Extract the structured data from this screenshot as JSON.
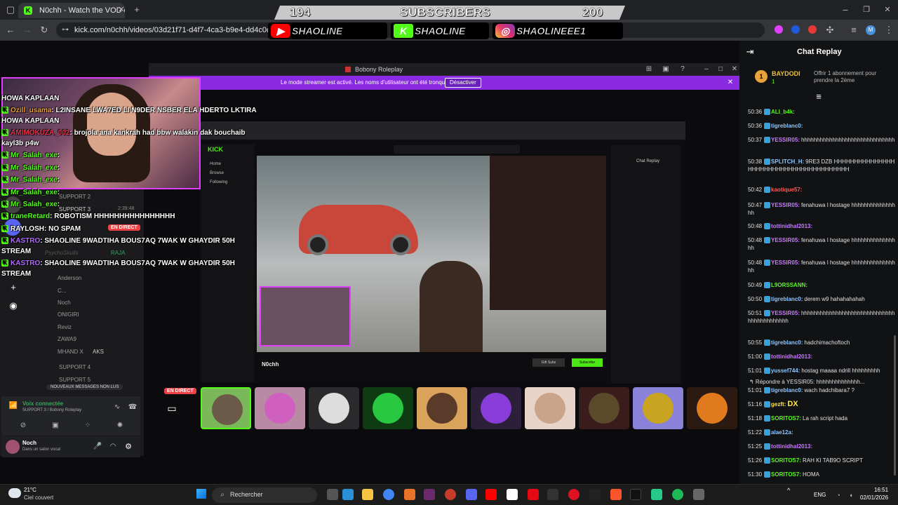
{
  "browser": {
    "tab_title": "N0chh - Watch the VOD on",
    "url": "kick.com/n0chh/videos/03d21f71-d4f7-4ca3-b9e4-dd4c0c97f576"
  },
  "overlay": {
    "sub_current": "194",
    "sub_label": "SUBSCRIBERS",
    "sub_goal": "200",
    "youtube": "SHAOLINE",
    "kick": "SHAOLINE",
    "instagram": "SHAOLINEEE1"
  },
  "game_window": {
    "title": "Bobony Roleplay",
    "streamer_notice": "Le mode streamer est activé. Les noms d'utilisateur ont été tronqués.",
    "disable_button": "Désactiver"
  },
  "stream_chat": [
    {
      "text": "HOWA KAPLAAN"
    },
    {
      "user": "Ozill_usama",
      "user_color": "#e9a23b",
      "msg": ": L2INSANE LWA7ED LI N9DER NSBER ELA HDERTO LKTIRA"
    },
    {
      "text": "HOWA KAPLAAN"
    },
    {
      "user": "AMIMOKUZA_002",
      "user_color": "#e8324a",
      "msg": ": brojola ana kankrah had bbw walakin dak bouchaib"
    },
    {
      "text": "kayl3b p4w"
    },
    {
      "user": "Mr_Salah_exe",
      "user_color": "#53fc18",
      "msg": ":"
    },
    {
      "user": "Mr_Salah_exe",
      "user_color": "#53fc18",
      "msg": ":"
    },
    {
      "user": "Mr_Salah_exe",
      "user_color": "#53fc18",
      "msg": ":"
    },
    {
      "user": "Mr_Salah_exe",
      "user_color": "#53fc18",
      "msg": ":"
    },
    {
      "user": "Mr_Salah_exe",
      "user_color": "#53fc18",
      "msg": ":"
    },
    {
      "user": "traneRetard",
      "user_color": "#53fc18",
      "msg": ": ROBOTISM HHHHHHHHHHHHHHHH"
    },
    {
      "user": "RAYLOSH",
      "user_color": "#ffffff",
      "msg": ": NO SPAM"
    },
    {
      "user": "KASTRO",
      "user_color": "#b36bff",
      "msg": ": SHAOLINE 9WADTIHA BOUS7AQ 7WAK W GHAYDIR 50H"
    },
    {
      "text": "STREAM"
    },
    {
      "user": "KASTRO",
      "user_color": "#b36bff",
      "msg": ": SHAOLINE 9WADTIHA BOUS7AQ 7WAK W GHAYDIR 50H"
    },
    {
      "text": "STREAM"
    }
  ],
  "discord": {
    "live_badge": "EN DIRECT",
    "live_badge2": "EN DIRECT",
    "channels": [
      "SUPPORT 2",
      "SUPPORT 3",
      "SUPPORT 4",
      "SUPPORT 5"
    ],
    "support3_time": "2:39:48",
    "members": [
      "PsychoSkulls",
      "RAJA",
      "Anderson",
      "C...",
      "Noch",
      "ONIGIRI",
      "Reviz",
      "ZAWA9",
      "MHAND X",
      "AKS"
    ],
    "new_messages": "NOUVEAUX MESSAGES NON LUS",
    "voice_connected": "Voix connectée",
    "voice_channel": "SUPPORT 3 / Bobony Roleplay",
    "user_name": "Noch",
    "user_status": "Dans un salon vocal"
  },
  "chat_replay": {
    "title": "Chat Replay",
    "pinned_user": "BAYDODI",
    "pinned_count": "1",
    "pinned_text": "Offrir 1 abonnement pour prendre la 2ème",
    "messages": [
      {
        "ts": "50:36",
        "user": "ALI_b4k:",
        "color": "#53fc18",
        "msg": ""
      },
      {
        "ts": "50:36",
        "user": "tigreblanc0:",
        "color": "#8ec7ff",
        "msg": ""
      },
      {
        "ts": "50:37",
        "user": "YESSIR05:",
        "color": "#c87bff",
        "msg": "hhhhhhhhhhhhhhhhhhhhhhhhhhhhhh"
      },
      {
        "ts": "50:38",
        "user": "SPLITCH_H:",
        "color": "#8ec7ff",
        "msg": "9RE3 DZB HHHHHHHHHHHHHHHHHHHHHHHHHHHHHHHHHHHHHHHH"
      },
      {
        "ts": "50:42",
        "user": "kaotique57:",
        "color": "#ff5a5a",
        "msg": ""
      },
      {
        "ts": "50:47",
        "user": "YESSIR05:",
        "color": "#c87bff",
        "msg": "fenahuwa l hostage hhhhhhhhhhhhhhhh"
      },
      {
        "ts": "50:48",
        "user": "tottinidhal2013:",
        "color": "#c87bff",
        "msg": ""
      },
      {
        "ts": "50:48",
        "user": "YESSIR05:",
        "color": "#c87bff",
        "msg": "fenahuwa l hostage hhhhhhhhhhhhhhhh"
      },
      {
        "ts": "50:48",
        "user": "YESSIR05:",
        "color": "#c87bff",
        "msg": "fenahuwa l hostage hhhhhhhhhhhhhhhh"
      },
      {
        "ts": "50:49",
        "user": "L9ORSSANN:",
        "color": "#53fc18",
        "msg": ""
      },
      {
        "ts": "50:50",
        "user": "tigreblanc0:",
        "color": "#8ec7ff",
        "msg": "derem w9 hahahahahah"
      },
      {
        "ts": "50:51",
        "user": "YESSIR05:",
        "color": "#c87bff",
        "msg": "hhhhhhhhhhhhhhhhhhhhhhhhhhhhhhhhhhhhhhhhhhh"
      },
      {
        "ts": "50:55",
        "user": "tigreblanc0:",
        "color": "#8ec7ff",
        "msg": "hadchimachoftoch"
      },
      {
        "ts": "51:00",
        "user": "tottinidhal2013:",
        "color": "#c87bff",
        "msg": ""
      },
      {
        "ts": "51:01",
        "user": "yussef744:",
        "color": "#8ec7ff",
        "msg": "hostag maaaa ndrill hhhhhhhhh"
      },
      {
        "ts": "",
        "user": "",
        "color": "#aaa",
        "msg": "↰ Répondre à YESSIR05: hhhhhhhhhhhhhh..."
      },
      {
        "ts": "51:01",
        "user": "tigreblanc0:",
        "color": "#8ec7ff",
        "msg": "wach hadchibara7 ?"
      },
      {
        "ts": "51:16",
        "user": "gezft:",
        "color": "#ffe14d",
        "msg": "DX"
      },
      {
        "ts": "51:18",
        "user": "SORITOS7:",
        "color": "#53fc18",
        "msg": "La rah script hada"
      },
      {
        "ts": "51:22",
        "user": "alae12a:",
        "color": "#8ec7ff",
        "msg": ""
      },
      {
        "ts": "51:25",
        "user": "tottinidhal2013:",
        "color": "#c87bff",
        "msg": ""
      },
      {
        "ts": "51:26",
        "user": "SORITOS7:",
        "color": "#53fc18",
        "msg": "RAH KI TAB9O SCRIPT"
      },
      {
        "ts": "51:30",
        "user": "SORITOS7:",
        "color": "#53fc18",
        "msg": "HOMA"
      }
    ]
  },
  "inner_screen": {
    "chat_replay": "Chat Replay",
    "channel": "N0chh",
    "subscribe": "Subscribe",
    "gift_subs": "Gift Subs",
    "following": "Following",
    "browse": "Browse",
    "home": "Home"
  },
  "taskbar": {
    "weather_temp": "21°C",
    "weather_desc": "Ciel couvert",
    "search": "Rechercher",
    "lang": "ENG",
    "time": "16:51",
    "date": "02/01/2026"
  }
}
